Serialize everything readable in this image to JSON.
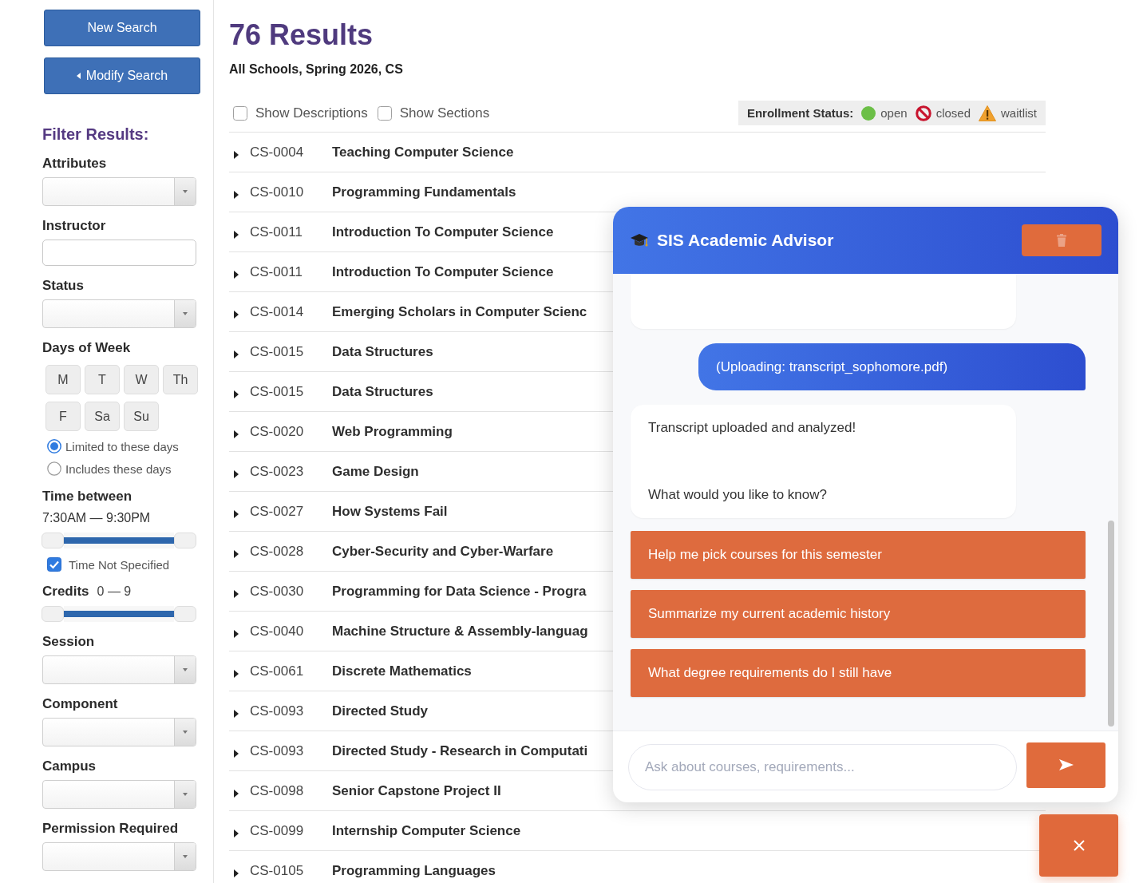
{
  "sidebar": {
    "buttons": [
      {
        "kind": "new",
        "label": "New Search"
      },
      {
        "kind": "modify",
        "label": "Modify Search"
      }
    ],
    "filter_title": "Filter Results:",
    "filters": [
      {
        "kind": "dropdown",
        "label": "Attributes"
      },
      {
        "kind": "text",
        "label": "Instructor"
      },
      {
        "kind": "dropdown",
        "label": "Status"
      },
      {
        "kind": "days",
        "label": "Days of Week",
        "days": [
          {
            "label": "M",
            "selected": false
          },
          {
            "label": "T",
            "selected": false
          },
          {
            "label": "W",
            "selected": false
          },
          {
            "label": "Th",
            "selected": false
          },
          {
            "label": "F",
            "selected": false
          },
          {
            "label": "Sa",
            "selected": false
          },
          {
            "label": "Su",
            "selected": false
          }
        ],
        "options": [
          {
            "label": "Limited to these days",
            "selected": true
          },
          {
            "label": "Includes these days",
            "selected": false
          }
        ]
      },
      {
        "kind": "range",
        "label": "Time between",
        "reading": "7:30AM — 9:30PM",
        "level": 1,
        "checkbox": {
          "label": "Time Not Specified",
          "checked": true
        }
      },
      {
        "kind": "inline",
        "label": "Credits",
        "reading": "0 — 9",
        "level": 1
      },
      {
        "kind": "dropdown",
        "label": "Session"
      },
      {
        "kind": "dropdown",
        "label": "Component"
      },
      {
        "kind": "dropdown",
        "label": "Campus"
      },
      {
        "kind": "dropdown",
        "label": "Permission Required"
      }
    ]
  },
  "results": {
    "title": "76 Results",
    "subtitle": "All Schools, Spring 2026, CS",
    "toggles": [
      {
        "label": "Show Descriptions",
        "checked": false
      },
      {
        "label": "Show Sections",
        "checked": false
      }
    ],
    "legend": {
      "label": "Enrollment Status:",
      "items": [
        {
          "kind": "open",
          "label": "open"
        },
        {
          "kind": "closed",
          "label": "closed"
        },
        {
          "kind": "waitlist",
          "label": "waitlist"
        }
      ]
    },
    "courses": [
      {
        "code": "CS-0004",
        "title": "Teaching Computer Science",
        "expanded": false
      },
      {
        "code": "CS-0010",
        "title": "Programming Fundamentals",
        "expanded": false
      },
      {
        "code": "CS-0011",
        "title": "Introduction To Computer Science",
        "expanded": false
      },
      {
        "code": "CS-0011",
        "title": "Introduction To Computer Science",
        "expanded": false
      },
      {
        "code": "CS-0014",
        "title": "Emerging Scholars in Computer Scienc",
        "expanded": false
      },
      {
        "code": "CS-0015",
        "title": "Data Structures",
        "expanded": false
      },
      {
        "code": "CS-0015",
        "title": "Data Structures",
        "expanded": false
      },
      {
        "code": "CS-0020",
        "title": "Web Programming",
        "expanded": false
      },
      {
        "code": "CS-0023",
        "title": "Game Design",
        "expanded": false
      },
      {
        "code": "CS-0027",
        "title": "How Systems Fail",
        "expanded": false
      },
      {
        "code": "CS-0028",
        "title": "Cyber-Security and Cyber-Warfare",
        "expanded": false
      },
      {
        "code": "CS-0030",
        "title": "Programming for Data Science - Progra",
        "expanded": false
      },
      {
        "code": "CS-0040",
        "title": "Machine Structure & Assembly-languag",
        "expanded": false
      },
      {
        "code": "CS-0061",
        "title": "Discrete Mathematics",
        "expanded": false
      },
      {
        "code": "CS-0093",
        "title": "Directed Study",
        "expanded": false
      },
      {
        "code": "CS-0093",
        "title": "Directed Study - Research in Computati",
        "expanded": false
      },
      {
        "code": "CS-0098",
        "title": "Senior Capstone Project II",
        "expanded": false
      },
      {
        "code": "CS-0099",
        "title": "Internship Computer Science",
        "expanded": false
      },
      {
        "code": "CS-0105",
        "title": "Programming Languages",
        "expanded": false
      }
    ]
  },
  "chat": {
    "title": "SIS Academic Advisor",
    "messages": [
      {
        "kind": "bot"
      },
      {
        "kind": "user",
        "text": "(Uploading: transcript_sophomore.pdf)"
      },
      {
        "kind": "bot",
        "paragraphs": [
          "Transcript uploaded and analyzed!",
          "What would you like to know?"
        ]
      }
    ],
    "suggestions": [
      "Help me pick courses for this semester",
      "Summarize my current academic history",
      "What degree requirements do I still have"
    ],
    "input": {
      "placeholder": "Ask about courses, requirements..."
    }
  }
}
